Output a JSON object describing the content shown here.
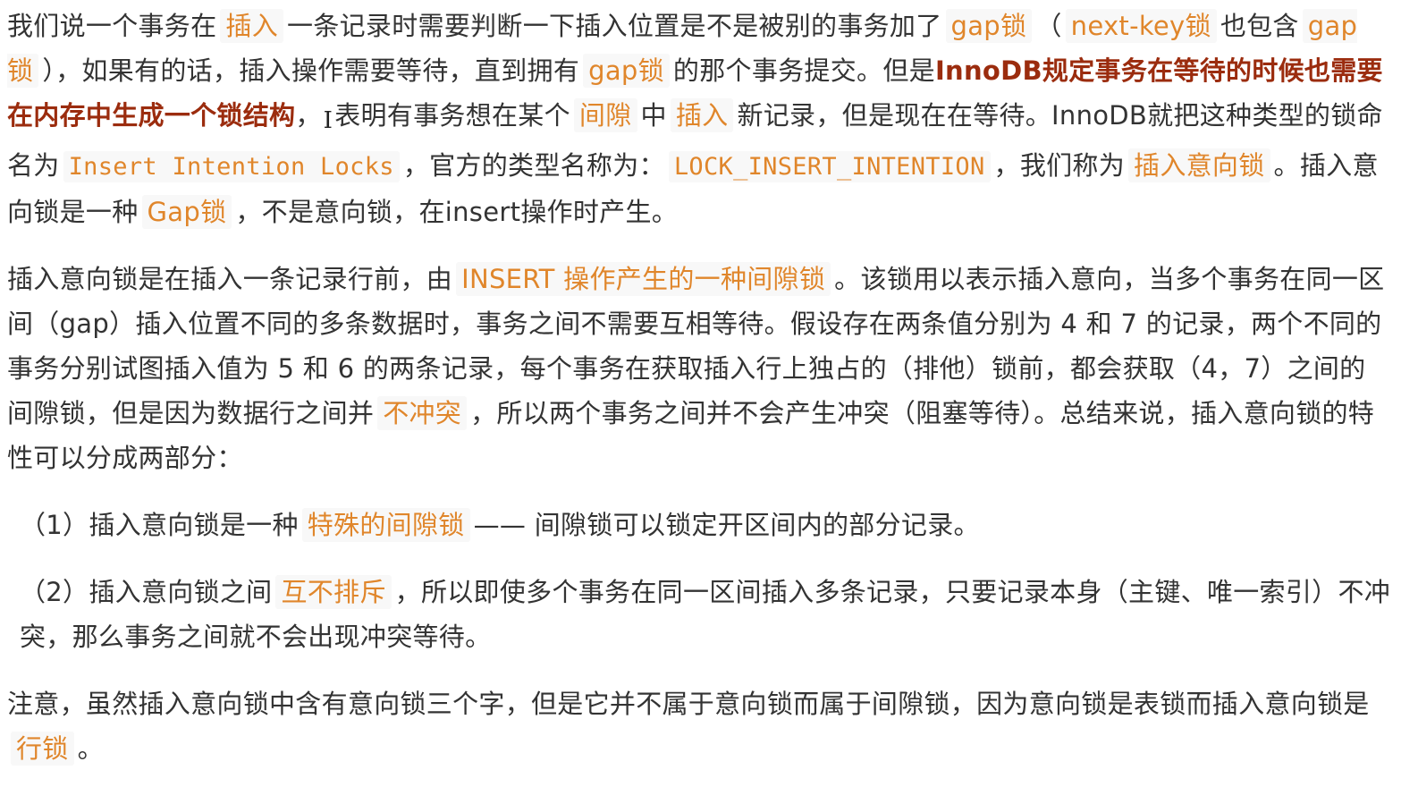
{
  "p1": {
    "t01": "我们说一个事务在",
    "c01": "插入",
    "t02": "一条记录时需要判断一下插入位置是不是被别的事务加了",
    "c02": "gap锁",
    "t03": "（",
    "c03": "next-key锁",
    "t04": "也包含",
    "c04": "gap锁",
    "t05": "），如果有的话，插入操作需要等待，直到拥有",
    "c05": "gap锁",
    "t06": "的那个事务提交。但是",
    "s01": "InnoDB规定事务在等待的时候也需要在内存中生成一个锁结构",
    "t07": "，",
    "cursor": "I",
    "t08": "表明有事务想在某个",
    "c06": "间隙",
    "t09": "中",
    "c07": "插入",
    "t10": "新记录，但是现在在等待。InnoDB就把这种类型的锁命名为",
    "c08": "Insert Intention Locks",
    "t11": "，官方的类型名称为：",
    "c09": "LOCK_INSERT_INTENTION",
    "t12": "，我们称为",
    "c10": "插入意向锁",
    "t13": "。插入意向锁是一种",
    "c11": "Gap锁",
    "t14": "，不是意向锁，在insert操作时产生。"
  },
  "p2": {
    "t01": "插入意向锁是在插入一条记录行前，由",
    "c01": "INSERT 操作产生的一种间隙锁",
    "t02": "。该锁用以表示插入意向，当多个事务在同一区间（gap）插入位置不同的多条数据时，事务之间不需要互相等待。假设存在两条值分别为 4 和 7 的记录，两个不同的事务分别试图插入值为 5 和 6 的两条记录，每个事务在获取插入行上独占的（排他）锁前，都会获取（4，7）之间的间隙锁，但是因为数据行之间并",
    "c02": "不冲突",
    "t03": "，所以两个事务之间并不会产生冲突（阻塞等待）。总结来说，插入意向锁的特性可以分成两部分："
  },
  "p3": {
    "t01": "（1）插入意向锁是一种",
    "c01": "特殊的间隙锁",
    "t02": "—— 间隙锁可以锁定开区间内的部分记录。"
  },
  "p4": {
    "t01": "（2）插入意向锁之间",
    "c01": "互不排斥",
    "t02": "，所以即使多个事务在同一区间插入多条记录，只要记录本身（主键、唯一索引）不冲突，那么事务之间就不会出现冲突等待。"
  },
  "p5": {
    "t01": "注意，虽然插入意向锁中含有意向锁三个字，但是它并不属于意向锁而属于间隙锁，因为意向锁是表锁而插入意向锁是",
    "c01": "行锁",
    "t02": "。"
  },
  "colors": {
    "text": "#333333",
    "code": "#e0862b",
    "code_bg": "#f8f8f8",
    "emphasis": "#9b2c0e"
  }
}
